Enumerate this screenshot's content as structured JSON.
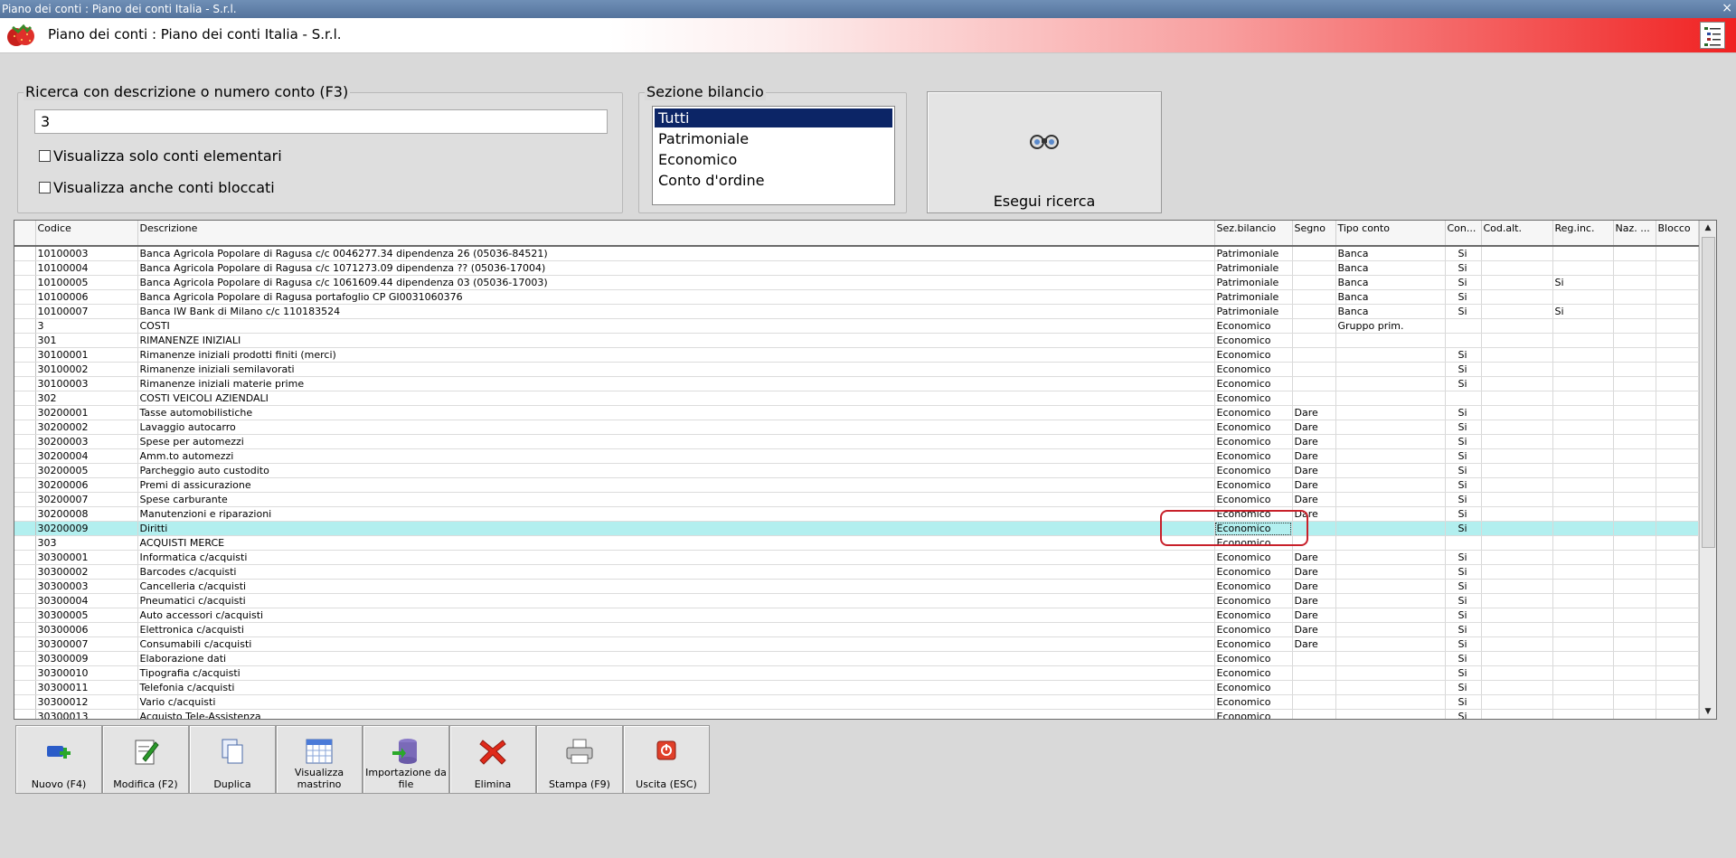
{
  "window": {
    "title": "Piano dei conti : Piano dei conti Italia - S.r.l.",
    "close_glyph": "×"
  },
  "header": {
    "title": "Piano dei conti : Piano dei conti Italia - S.r.l.",
    "logo_icon": "strawberry-icon",
    "menu_icon": "tree-list-icon"
  },
  "search": {
    "legend": "Ricerca con descrizione o numero conto (F3)",
    "value": "3",
    "only_elementary_label": "Visualizza solo conti elementari",
    "only_elementary_checked": false,
    "show_blocked_label": "Visualizza anche conti bloccati",
    "show_blocked_checked": false
  },
  "sezione": {
    "legend": "Sezione bilancio",
    "options": [
      "Tutti",
      "Patrimoniale",
      "Economico",
      "Conto d'ordine"
    ],
    "selected": "Tutti"
  },
  "run_button": {
    "label": "Esegui ricerca",
    "icon": "binoculars-icon"
  },
  "grid": {
    "columns": [
      "Codice",
      "Descrizione",
      "Sez.bilancio",
      "Segno",
      "Tipo conto",
      "Con...",
      "Cod.alt.",
      "Reg.inc.",
      "Naz. ...",
      "Blocco"
    ],
    "rows": [
      [
        "10100003",
        "Banca Agricola Popolare di Ragusa c/c 0046277.34 dipendenza 26 (05036-84521)",
        "Patrimoniale",
        "",
        "Banca",
        "Si",
        "",
        "",
        "",
        ""
      ],
      [
        "10100004",
        "Banca Agricola Popolare di Ragusa c/c 1071273.09 dipendenza ?? (05036-17004)",
        "Patrimoniale",
        "",
        "Banca",
        "Si",
        "",
        "",
        "",
        ""
      ],
      [
        "10100005",
        "Banca Agricola Popolare di Ragusa c/c 1061609.44 dipendenza 03 (05036-17003)",
        "Patrimoniale",
        "",
        "Banca",
        "Si",
        "",
        "Si",
        "",
        ""
      ],
      [
        "10100006",
        "Banca Agricola Popolare di Ragusa portafoglio CP GI0031060376",
        "Patrimoniale",
        "",
        "Banca",
        "Si",
        "",
        "",
        "",
        ""
      ],
      [
        "10100007",
        "Banca IW Bank di Milano c/c 110183524",
        "Patrimoniale",
        "",
        "Banca",
        "Si",
        "",
        "Si",
        "",
        ""
      ],
      [
        "3",
        "COSTI",
        "Economico",
        "",
        "Gruppo prim.",
        "",
        "",
        "",
        "",
        ""
      ],
      [
        "301",
        "RIMANENZE INIZIALI",
        "Economico",
        "",
        "",
        "",
        "",
        "",
        "",
        ""
      ],
      [
        "30100001",
        "Rimanenze iniziali prodotti finiti (merci)",
        "Economico",
        "",
        "",
        "Si",
        "",
        "",
        "",
        ""
      ],
      [
        "30100002",
        "Rimanenze iniziali semilavorati",
        "Economico",
        "",
        "",
        "Si",
        "",
        "",
        "",
        ""
      ],
      [
        "30100003",
        "Rimanenze iniziali materie prime",
        "Economico",
        "",
        "",
        "Si",
        "",
        "",
        "",
        ""
      ],
      [
        "302",
        "COSTI VEICOLI AZIENDALI",
        "Economico",
        "",
        "",
        "",
        "",
        "",
        "",
        ""
      ],
      [
        "30200001",
        "Tasse automobilistiche",
        "Economico",
        "Dare",
        "",
        "Si",
        "",
        "",
        "",
        ""
      ],
      [
        "30200002",
        "Lavaggio autocarro",
        "Economico",
        "Dare",
        "",
        "Si",
        "",
        "",
        "",
        ""
      ],
      [
        "30200003",
        "Spese per automezzi",
        "Economico",
        "Dare",
        "",
        "Si",
        "",
        "",
        "",
        ""
      ],
      [
        "30200004",
        "Amm.to automezzi",
        "Economico",
        "Dare",
        "",
        "Si",
        "",
        "",
        "",
        ""
      ],
      [
        "30200005",
        "Parcheggio auto custodito",
        "Economico",
        "Dare",
        "",
        "Si",
        "",
        "",
        "",
        ""
      ],
      [
        "30200006",
        "Premi di assicurazione",
        "Economico",
        "Dare",
        "",
        "Si",
        "",
        "",
        "",
        ""
      ],
      [
        "30200007",
        "Spese carburante",
        "Economico",
        "Dare",
        "",
        "Si",
        "",
        "",
        "",
        ""
      ],
      [
        "30200008",
        "Manutenzioni e riparazioni",
        "Economico",
        "Dare",
        "",
        "Si",
        "",
        "",
        "",
        ""
      ],
      [
        "30200009",
        "Diritti",
        "Economico",
        "",
        "",
        "Si",
        "",
        "",
        "",
        ""
      ],
      [
        "303",
        "ACQUISTI MERCE",
        "Economico",
        "",
        "",
        "",
        "",
        "",
        "",
        ""
      ],
      [
        "30300001",
        "Informatica c/acquisti",
        "Economico",
        "Dare",
        "",
        "Si",
        "",
        "",
        "",
        ""
      ],
      [
        "30300002",
        "Barcodes c/acquisti",
        "Economico",
        "Dare",
        "",
        "Si",
        "",
        "",
        "",
        ""
      ],
      [
        "30300003",
        "Cancelleria c/acquisti",
        "Economico",
        "Dare",
        "",
        "Si",
        "",
        "",
        "",
        ""
      ],
      [
        "30300004",
        "Pneumatici c/acquisti",
        "Economico",
        "Dare",
        "",
        "Si",
        "",
        "",
        "",
        ""
      ],
      [
        "30300005",
        "Auto accessori c/acquisti",
        "Economico",
        "Dare",
        "",
        "Si",
        "",
        "",
        "",
        ""
      ],
      [
        "30300006",
        "Elettronica c/acquisti",
        "Economico",
        "Dare",
        "",
        "Si",
        "",
        "",
        "",
        ""
      ],
      [
        "30300007",
        "Consumabili c/acquisti",
        "Economico",
        "Dare",
        "",
        "Si",
        "",
        "",
        "",
        ""
      ],
      [
        "30300009",
        "Elaborazione dati",
        "Economico",
        "",
        "",
        "Si",
        "",
        "",
        "",
        ""
      ],
      [
        "30300010",
        "Tipografia c/acquisti",
        "Economico",
        "",
        "",
        "Si",
        "",
        "",
        "",
        ""
      ],
      [
        "30300011",
        "Telefonia c/acquisti",
        "Economico",
        "",
        "",
        "Si",
        "",
        "",
        "",
        ""
      ],
      [
        "30300012",
        "Vario c/acquisti",
        "Economico",
        "",
        "",
        "Si",
        "",
        "",
        "",
        ""
      ],
      [
        "30300013",
        "Acquisto Tele-Assistenza",
        "Economico",
        "",
        "",
        "Si",
        "",
        "",
        "",
        ""
      ]
    ],
    "highlighted_row": 19,
    "colors": {
      "highlight": "#b2efef",
      "annotation": "#c8202a",
      "selection": "#0c2566"
    }
  },
  "toolbar": {
    "buttons": [
      {
        "label": "Nuovo (F4)",
        "icon": "add-record-icon"
      },
      {
        "label": "Modifica (F2)",
        "icon": "edit-document-icon"
      },
      {
        "label": "Duplica",
        "icon": "duplicate-icon"
      },
      {
        "label": "Visualizza mastrino",
        "icon": "calendar-grid-icon"
      },
      {
        "label": "Importazione da file",
        "icon": "database-import-icon"
      },
      {
        "label": "Elimina",
        "icon": "delete-x-icon"
      },
      {
        "label": "Stampa (F9)",
        "icon": "printer-icon"
      },
      {
        "label": "Uscita (ESC)",
        "icon": "exit-power-icon"
      }
    ]
  }
}
